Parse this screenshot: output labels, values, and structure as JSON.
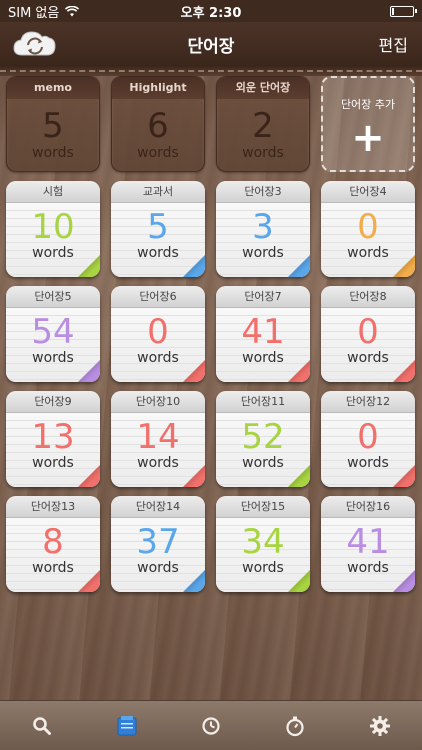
{
  "status_bar": {
    "carrier": "SIM 없음",
    "time": "오후 2:30",
    "battery_level": 0.1
  },
  "nav": {
    "title": "단어장",
    "edit_label": "편집"
  },
  "special_boxes": [
    {
      "label": "memo",
      "count": "5",
      "unit": "words"
    },
    {
      "label": "Highlight",
      "count": "6",
      "unit": "words"
    },
    {
      "label": "외운 단어장",
      "count": "2",
      "unit": "words"
    }
  ],
  "add_box": {
    "label": "단어장 추가",
    "symbol": "+"
  },
  "decks": [
    {
      "name": "시험",
      "count": "10",
      "unit": "words",
      "color": "#a7d440"
    },
    {
      "name": "교과서",
      "count": "5",
      "unit": "words",
      "color": "#5aa6ea"
    },
    {
      "name": "단어장3",
      "count": "3",
      "unit": "words",
      "color": "#5aa6ea"
    },
    {
      "name": "단어장4",
      "count": "0",
      "unit": "words",
      "color": "#f2ac4a"
    },
    {
      "name": "단어장5",
      "count": "54",
      "unit": "words",
      "color": "#b98ee2"
    },
    {
      "name": "단어장6",
      "count": "0",
      "unit": "words",
      "color": "#f2706b"
    },
    {
      "name": "단어장7",
      "count": "41",
      "unit": "words",
      "color": "#f2706b"
    },
    {
      "name": "단어장8",
      "count": "0",
      "unit": "words",
      "color": "#f2706b"
    },
    {
      "name": "단어장9",
      "count": "13",
      "unit": "words",
      "color": "#f2706b"
    },
    {
      "name": "단어장10",
      "count": "14",
      "unit": "words",
      "color": "#f2706b"
    },
    {
      "name": "단어장11",
      "count": "52",
      "unit": "words",
      "color": "#a7d440"
    },
    {
      "name": "단어장12",
      "count": "0",
      "unit": "words",
      "color": "#f2706b"
    },
    {
      "name": "단어장13",
      "count": "8",
      "unit": "words",
      "color": "#f2706b"
    },
    {
      "name": "단어장14",
      "count": "37",
      "unit": "words",
      "color": "#5aa6ea"
    },
    {
      "name": "단어장15",
      "count": "34",
      "unit": "words",
      "color": "#a7d440"
    },
    {
      "name": "단어장16",
      "count": "41",
      "unit": "words",
      "color": "#b98ee2"
    }
  ],
  "tab_bar": [
    {
      "icon": "search-icon"
    },
    {
      "icon": "wordbook-icon",
      "active": true
    },
    {
      "icon": "clock-icon"
    },
    {
      "icon": "stopwatch-icon"
    },
    {
      "icon": "gear-icon"
    }
  ]
}
